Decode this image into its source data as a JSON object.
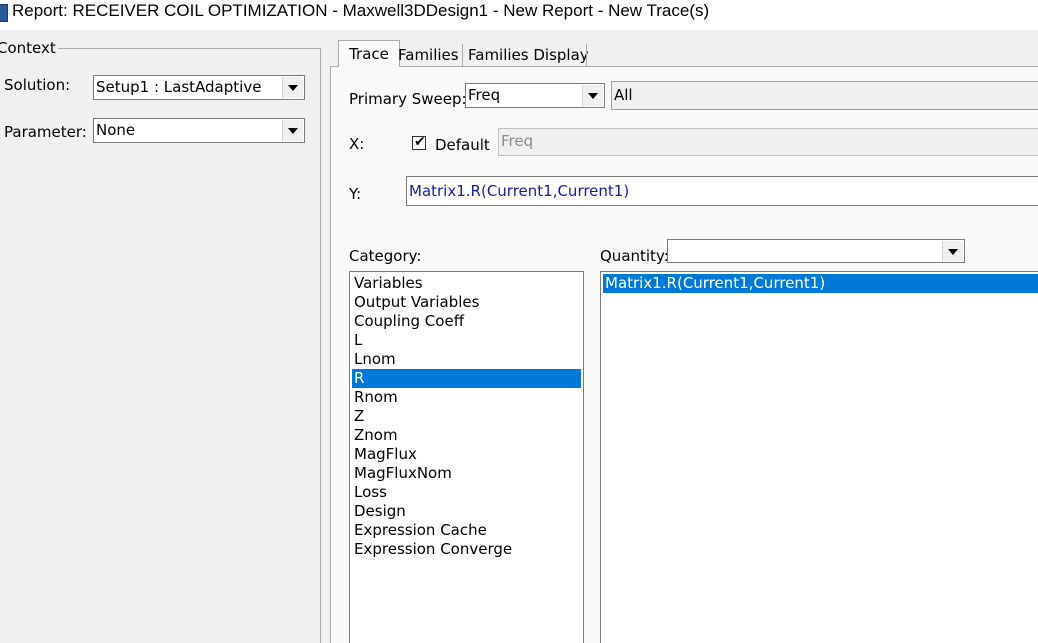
{
  "window": {
    "title": "Report: RECEIVER COIL OPTIMIZATION - Maxwell3DDesign1 - New Report - New Trace(s)"
  },
  "context": {
    "legend": "Context",
    "solution_label": "Solution:",
    "solution_value": "Setup1 : LastAdaptive",
    "parameter_label": "Parameter:",
    "parameter_value": "None"
  },
  "tabs": [
    {
      "label": "Trace",
      "active": true
    },
    {
      "label": "Families",
      "active": false
    },
    {
      "label": "Families Display",
      "active": false
    }
  ],
  "trace": {
    "primary_sweep_label": "Primary Sweep:",
    "primary_sweep_value": "Freq",
    "primary_sweep_range": "All",
    "x_label": "X:",
    "default_label": "Default",
    "default_checked": true,
    "x_value": "Freq",
    "y_label": "Y:",
    "y_value": "Matrix1.R(Current1,Current1)",
    "category_label": "Category:",
    "quantity_label": "Quantity:",
    "quantity_filter": "",
    "categories": [
      "Variables",
      "Output Variables",
      "Coupling Coeff",
      "L",
      "Lnom",
      "R",
      "Rnom",
      "Z",
      "Znom",
      "MagFlux",
      "MagFluxNom",
      "Loss",
      "Design",
      "Expression Cache",
      "Expression Converge"
    ],
    "selected_category": "R",
    "quantities": [
      "Matrix1.R(Current1,Current1)"
    ],
    "selected_quantity": "Matrix1.R(Current1,Current1)"
  },
  "colors": {
    "selection": "#0078d7",
    "y_text": "#1a1aa6"
  }
}
